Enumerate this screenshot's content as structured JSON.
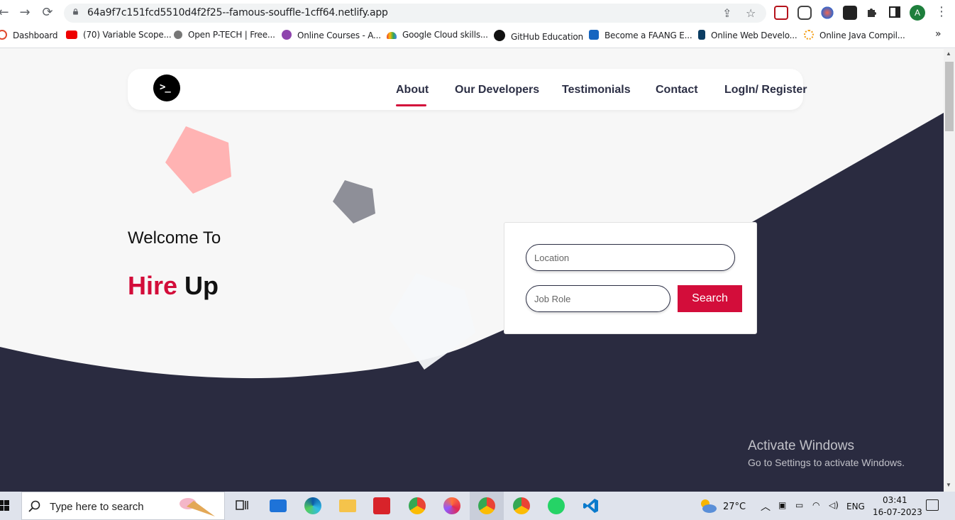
{
  "browser": {
    "url": "64a9f7c151fcd5510d4f2f25--famous-souffle-1cff64.netlify.app",
    "profile_initial": "A",
    "bookmarks": [
      {
        "label": "Dashboard",
        "icon": "dashboard-icon"
      },
      {
        "label": "(70) Variable Scope...",
        "icon": "youtube-icon"
      },
      {
        "label": "Open P-TECH | Free...",
        "icon": "ptech-icon"
      },
      {
        "label": "Online Courses - A...",
        "icon": "courses-icon"
      },
      {
        "label": "Google Cloud skills...",
        "icon": "google-cloud-icon"
      },
      {
        "label": "GitHub Education",
        "icon": "github-icon"
      },
      {
        "label": "Become a FAANG E...",
        "icon": "faang-icon"
      },
      {
        "label": "Online Web Develo...",
        "icon": "webdev-icon"
      },
      {
        "label": "Online Java Compil...",
        "icon": "java-icon"
      }
    ],
    "more_bookmarks": "»"
  },
  "site": {
    "nav": {
      "about": "About",
      "developers": "Our Developers",
      "testimonials": "Testimonials",
      "contact": "Contact",
      "login": "LogIn/ Register"
    },
    "logo_glyph": ">_",
    "hero": {
      "welcome": "Welcome To",
      "brand_hire": "Hire",
      "brand_up": "Up"
    },
    "search": {
      "location_placeholder": "Location",
      "job_role_placeholder": "Job Role",
      "button_label": "Search"
    },
    "colors": {
      "accent": "#d30d3a",
      "dark": "#2c2f45",
      "pentagon_pink": "#ffb3b3",
      "pentagon_gray": "#8e8f98"
    }
  },
  "watermark": {
    "title": "Activate Windows",
    "subtitle": "Go to Settings to activate Windows."
  },
  "taskbar": {
    "search_placeholder": "Type here to search",
    "weather": "27°C",
    "language": "ENG",
    "time": "03:41",
    "date": "16-07-2023"
  }
}
